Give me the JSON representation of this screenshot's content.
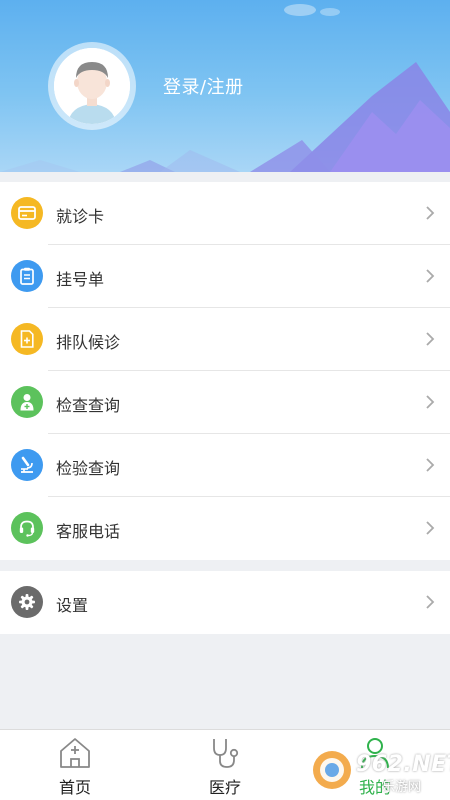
{
  "header": {
    "login_label": "登录/注册"
  },
  "menu": {
    "items": [
      {
        "label": "就诊卡",
        "icon": "card-icon",
        "color": "#f5b823"
      },
      {
        "label": "挂号单",
        "icon": "clipboard-icon",
        "color": "#3e9af0"
      },
      {
        "label": "排队候诊",
        "icon": "queue-document-icon",
        "color": "#f5b823"
      },
      {
        "label": "检查查询",
        "icon": "doctor-person-icon",
        "color": "#5cc25c"
      },
      {
        "label": "检验查询",
        "icon": "microscope-icon",
        "color": "#3e9af0"
      },
      {
        "label": "客服电话",
        "icon": "headset-icon",
        "color": "#5cc25c"
      }
    ]
  },
  "settings": {
    "label": "设置",
    "icon": "gear-icon",
    "color": "#6b6b6b"
  },
  "tabbar": {
    "tabs": [
      {
        "label": "首页",
        "icon": "hospital-home-icon"
      },
      {
        "label": "医疗",
        "icon": "stethoscope-icon"
      },
      {
        "label": "我的",
        "icon": "person-icon",
        "active_color": "#2fb24c"
      }
    ]
  },
  "watermark": {
    "text": "962.NET",
    "sub": "乐游网"
  }
}
